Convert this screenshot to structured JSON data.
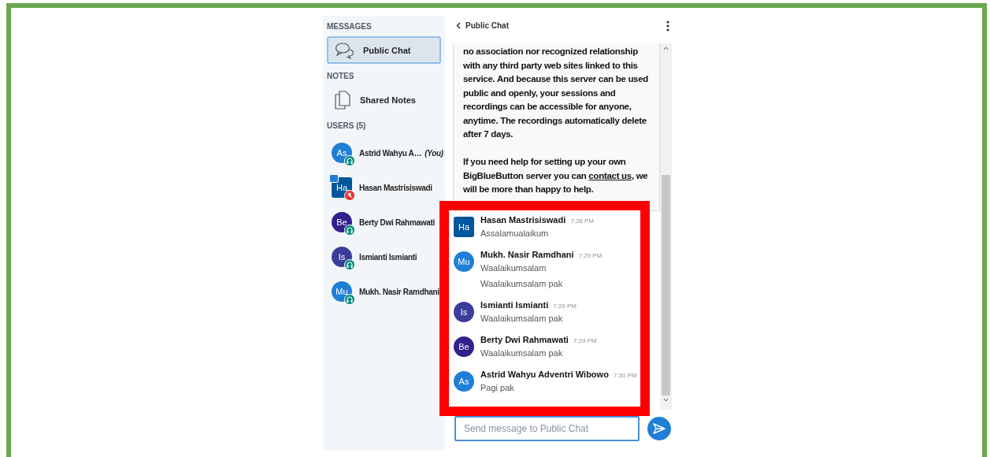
{
  "sidebar": {
    "sections": [
      {
        "title": "MESSAGES",
        "items": [
          {
            "label": "Public Chat",
            "kind": "chat",
            "selected": true
          }
        ]
      },
      {
        "title": "NOTES",
        "items": [
          {
            "label": "Shared Notes",
            "kind": "notes",
            "selected": false
          }
        ]
      }
    ],
    "users_title": "USERS (5)",
    "users": [
      {
        "initials": "As",
        "name": "Astrid Wahyu A…",
        "you": "(You)",
        "color": "#1f7ed6",
        "moderator": false,
        "presenter": false,
        "muted": false
      },
      {
        "initials": "Ha",
        "name": "Hasan Mastrisiswadi",
        "color": "#00569c",
        "moderator": true,
        "presenter": true,
        "muted": true
      },
      {
        "initials": "Be",
        "name": "Berty Dwi Rahmawati",
        "color": "#32208c",
        "moderator": false,
        "presenter": false,
        "muted": false
      },
      {
        "initials": "Is",
        "name": "Ismianti Ismianti",
        "color": "#3b3d9a",
        "moderator": false,
        "presenter": false,
        "muted": false
      },
      {
        "initials": "Mu",
        "name": "Mukh. Nasir Ramdhani",
        "color": "#1f7ed6",
        "moderator": false,
        "presenter": false,
        "muted": false
      }
    ]
  },
  "chat": {
    "title": "Public Chat",
    "welcome": [
      {
        "text": "no association nor recognized relationship with any third party web sites linked to this service. And because this server can be used public and openly, your sessions and recordings can be accessible for anyone, anytime. The recordings automatically delete after 7 days."
      },
      {
        "text": "If you need help for setting up your own BigBlueButton server you can ",
        "link": "contact us",
        "after": ", we will be more than happy to help."
      }
    ],
    "messages": [
      {
        "initials": "Ha",
        "color": "#00569c",
        "moderator": true,
        "name": "Hasan Mastrisiswadi",
        "time": "7:28 PM",
        "texts": [
          "Assalamualaikum"
        ]
      },
      {
        "initials": "Mu",
        "color": "#1f7ed6",
        "moderator": false,
        "name": "Mukh. Nasir Ramdhani",
        "time": "7:29 PM",
        "texts": [
          "Waalaikumsalam",
          "Waalaikumsalam pak"
        ]
      },
      {
        "initials": "Is",
        "color": "#3b3d9a",
        "moderator": false,
        "name": "Ismianti Ismianti",
        "time": "7:29 PM",
        "texts": [
          "Waalaikumsalam pak"
        ]
      },
      {
        "initials": "Be",
        "color": "#32208c",
        "moderator": false,
        "name": "Berty Dwi Rahmawati",
        "time": "7:29 PM",
        "texts": [
          "Waalaikumsalam pak"
        ]
      },
      {
        "initials": "As",
        "color": "#1f7ed6",
        "moderator": false,
        "name": "Astrid Wahyu Adventri Wibowo",
        "time": "7:30 PM",
        "texts": [
          "Pagi pak"
        ]
      }
    ],
    "input": {
      "placeholder": "Send message to Public Chat"
    }
  }
}
